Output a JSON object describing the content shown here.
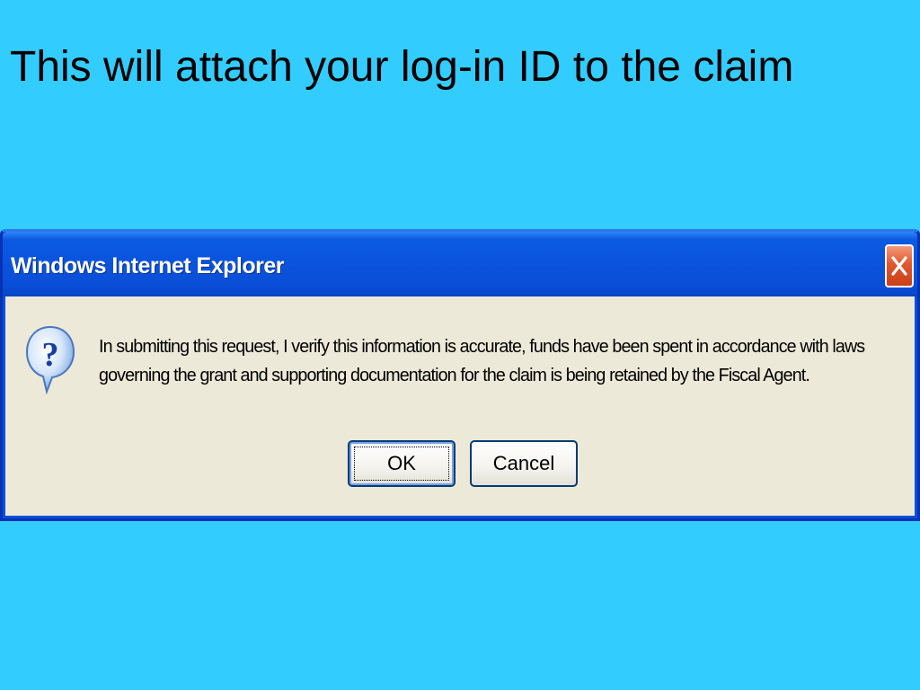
{
  "slide": {
    "title": "This will attach your log-in ID to the claim"
  },
  "dialog": {
    "title": "Windows Internet Explorer",
    "message": "In submitting this request, I verify this information is accurate, funds have been spent in accordance with laws governing the grant and supporting documentation for the claim is being retained by the Fiscal Agent.",
    "icon": "question-icon",
    "close_icon": "close-icon",
    "buttons": {
      "ok_label": "OK",
      "cancel_label": "Cancel"
    }
  },
  "colors": {
    "background": "#33ccff",
    "titlebar": "#0a53dd",
    "client": "#ece9d8",
    "close_button": "#e2572b"
  }
}
